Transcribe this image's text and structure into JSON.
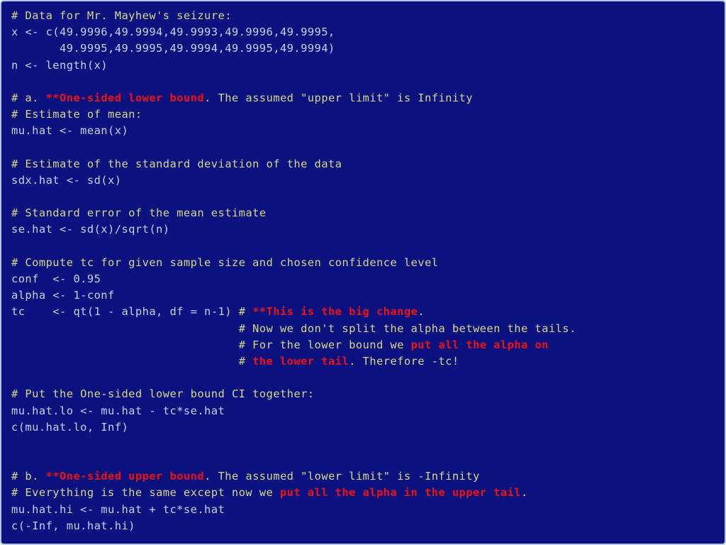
{
  "slide": {
    "kind": "r-code-listing",
    "colors": {
      "background": "#0b1280",
      "border": "#b9c4f2",
      "comment": "#d6d68c",
      "code": "#c4d2f4",
      "emphasis": "#ef1111"
    }
  },
  "lines": [
    {
      "id": "l01",
      "name": "comment-data-header",
      "segments": [
        {
          "style": "cm",
          "text": "# Data for Mr. Mayhew's seizure:"
        }
      ]
    },
    {
      "id": "l02",
      "name": "code-x-assign",
      "segments": [
        {
          "style": "code",
          "text": "x <- c(49.9996,49.9994,49.9993,49.9996,49.9995,"
        }
      ]
    },
    {
      "id": "l03",
      "name": "code-x-continuation",
      "segments": [
        {
          "style": "code",
          "text": "       49.9995,49.9995,49.9994,49.9995,49.9994)"
        }
      ]
    },
    {
      "id": "l04",
      "name": "code-n-assign",
      "segments": [
        {
          "style": "code",
          "text": "n <- length(x)"
        }
      ]
    },
    {
      "id": "l05",
      "name": "blank-line",
      "segments": []
    },
    {
      "id": "l06",
      "name": "comment-part-a-heading",
      "segments": [
        {
          "style": "cm",
          "text": "# a. "
        },
        {
          "style": "em",
          "text": "**One-sided lower bound"
        },
        {
          "style": "cm",
          "text": ". The assumed \"upper limit\" is Infinity"
        }
      ]
    },
    {
      "id": "l07",
      "name": "comment-estimate-of-mean",
      "segments": [
        {
          "style": "cm",
          "text": "# Estimate of mean:"
        }
      ]
    },
    {
      "id": "l08",
      "name": "code-mu-hat",
      "segments": [
        {
          "style": "code",
          "text": "mu.hat <- mean(x)"
        }
      ]
    },
    {
      "id": "l09",
      "name": "blank-line",
      "segments": []
    },
    {
      "id": "l10",
      "name": "comment-estimate-of-sd",
      "segments": [
        {
          "style": "cm",
          "text": "# Estimate of the standard deviation of the data"
        }
      ]
    },
    {
      "id": "l11",
      "name": "code-sdx-hat",
      "segments": [
        {
          "style": "code",
          "text": "sdx.hat <- sd(x)"
        }
      ]
    },
    {
      "id": "l12",
      "name": "blank-line",
      "segments": []
    },
    {
      "id": "l13",
      "name": "comment-standard-error",
      "segments": [
        {
          "style": "cm",
          "text": "# Standard error of the mean estimate"
        }
      ]
    },
    {
      "id": "l14",
      "name": "code-se-hat",
      "segments": [
        {
          "style": "code",
          "text": "se.hat <- sd(x)/sqrt(n)"
        }
      ]
    },
    {
      "id": "l15",
      "name": "blank-line",
      "segments": []
    },
    {
      "id": "l16",
      "name": "comment-compute-tc",
      "segments": [
        {
          "style": "cm",
          "text": "# Compute tc for given sample size and chosen confidence level"
        }
      ]
    },
    {
      "id": "l17",
      "name": "code-conf",
      "segments": [
        {
          "style": "code",
          "text": "conf  <- 0.95"
        }
      ]
    },
    {
      "id": "l18",
      "name": "code-alpha",
      "segments": [
        {
          "style": "code",
          "text": "alpha <- 1-conf"
        }
      ]
    },
    {
      "id": "l19",
      "name": "code-tc-with-comment",
      "segments": [
        {
          "style": "code",
          "text": "tc    <- qt(1 - alpha, df = n-1) "
        },
        {
          "style": "cm",
          "text": "# "
        },
        {
          "style": "em",
          "text": "**This is the big change"
        },
        {
          "style": "cm",
          "text": "."
        }
      ]
    },
    {
      "id": "l20",
      "name": "comment-no-split-alpha",
      "segments": [
        {
          "style": "cm",
          "text": "                                 # Now we don't split the alpha between the tails."
        }
      ]
    },
    {
      "id": "l21",
      "name": "comment-lower-bound-alpha",
      "segments": [
        {
          "style": "cm",
          "text": "                                 # For the lower bound we "
        },
        {
          "style": "em",
          "text": "put all the alpha on"
        }
      ]
    },
    {
      "id": "l22",
      "name": "comment-lower-tail-therefore",
      "segments": [
        {
          "style": "cm",
          "text": "                                 # "
        },
        {
          "style": "em",
          "text": "the lower tail"
        },
        {
          "style": "cm",
          "text": ". Therefore -tc!"
        }
      ]
    },
    {
      "id": "l23",
      "name": "blank-line",
      "segments": []
    },
    {
      "id": "l24",
      "name": "comment-put-lower-ci-together",
      "segments": [
        {
          "style": "cm",
          "text": "# Put the One-sided lower bound CI together:"
        }
      ]
    },
    {
      "id": "l25",
      "name": "code-mu-hat-lo",
      "segments": [
        {
          "style": "code",
          "text": "mu.hat.lo <- mu.hat - tc*se.hat"
        }
      ]
    },
    {
      "id": "l26",
      "name": "code-c-lower-inf",
      "segments": [
        {
          "style": "code",
          "text": "c(mu.hat.lo, Inf)"
        }
      ]
    },
    {
      "id": "l27",
      "name": "blank-line",
      "segments": []
    },
    {
      "id": "l28",
      "name": "blank-line",
      "segments": []
    },
    {
      "id": "l29",
      "name": "comment-part-b-heading",
      "segments": [
        {
          "style": "cm",
          "text": "# b. "
        },
        {
          "style": "em",
          "text": "**One-sided upper bound"
        },
        {
          "style": "cm",
          "text": ". The assumed \"lower limit\" is -Infinity"
        }
      ]
    },
    {
      "id": "l30",
      "name": "comment-everything-same-upper-tail",
      "segments": [
        {
          "style": "cm",
          "text": "# Everything is the same except now we "
        },
        {
          "style": "em",
          "text": "put all the alpha in the upper tail"
        },
        {
          "style": "cm",
          "text": "."
        }
      ]
    },
    {
      "id": "l31",
      "name": "code-mu-hat-hi",
      "segments": [
        {
          "style": "code",
          "text": "mu.hat.hi <- mu.hat + tc*se.hat"
        }
      ]
    },
    {
      "id": "l32",
      "name": "code-c-neg-inf-upper",
      "segments": [
        {
          "style": "code",
          "text": "c(-Inf, mu.hat.hi)"
        }
      ]
    }
  ]
}
